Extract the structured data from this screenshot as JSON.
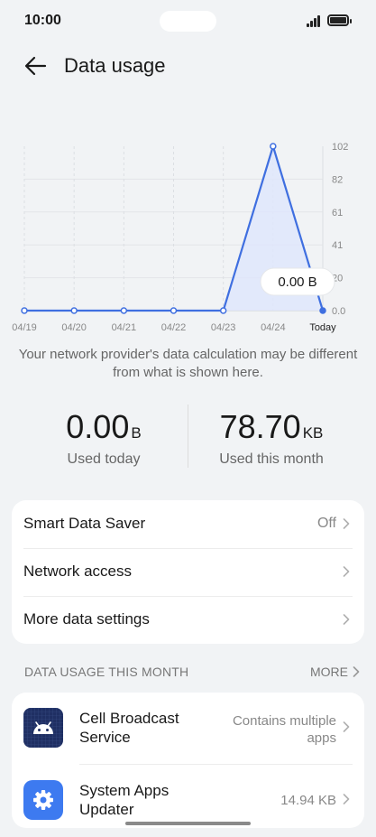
{
  "status_bar": {
    "time": "10:00"
  },
  "header": {
    "title": "Data usage"
  },
  "chart_data": {
    "type": "line",
    "categories": [
      "04/19",
      "04/20",
      "04/21",
      "04/22",
      "04/23",
      "04/24",
      "Today"
    ],
    "series": [
      {
        "values": [
          0,
          0,
          0,
          0,
          0,
          102,
          0
        ]
      }
    ],
    "y_ticks": [
      "102",
      "82",
      "61",
      "41",
      "20",
      "0.0"
    ],
    "ylim": [
      0,
      102
    ],
    "grid": true,
    "tooltip": "0.00 B",
    "line_color": "#3f6fe0",
    "area_color": "#dfe6fb"
  },
  "note": "Your network provider's data calculation may be different from what is shown here.",
  "stats": {
    "today": {
      "value": "0.00",
      "unit": "B",
      "label": "Used today"
    },
    "month": {
      "value": "78.70",
      "unit": "KB",
      "label": "Used this month"
    }
  },
  "settings": [
    {
      "label": "Smart Data Saver",
      "value": "Off"
    },
    {
      "label": "Network access",
      "value": ""
    },
    {
      "label": "More data settings",
      "value": ""
    }
  ],
  "usage_section": {
    "title": "DATA USAGE THIS MONTH",
    "more": "MORE"
  },
  "apps": [
    {
      "name": "Cell Broadcast Service",
      "size": "Contains multiple apps",
      "icon": "android-icon"
    },
    {
      "name": "System Apps Updater",
      "size": "14.94 KB",
      "icon": "gear-icon"
    }
  ]
}
